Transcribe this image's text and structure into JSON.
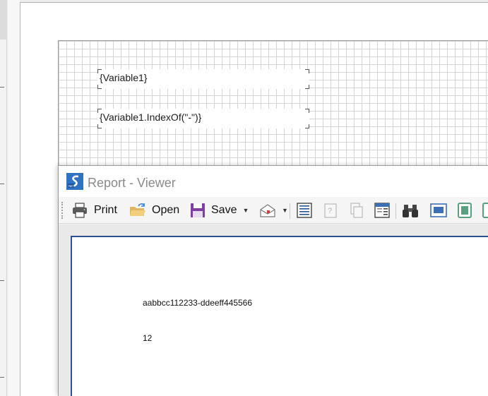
{
  "designer": {
    "textboxes": [
      {
        "expression": "{Variable1}"
      },
      {
        "expression": "{Variable1.IndexOf(\"-\")}"
      }
    ]
  },
  "viewer": {
    "title": "Report - Viewer",
    "toolbar": {
      "print_label": "Print",
      "open_label": "Open",
      "save_label": "Save"
    },
    "report": {
      "line1": "aabbcc112233-ddeeff445566",
      "line2": "12"
    }
  },
  "colors": {
    "page_border": "#2c4f8f",
    "logo": "#2e72c4",
    "save_icon": "#7e3fa0"
  }
}
